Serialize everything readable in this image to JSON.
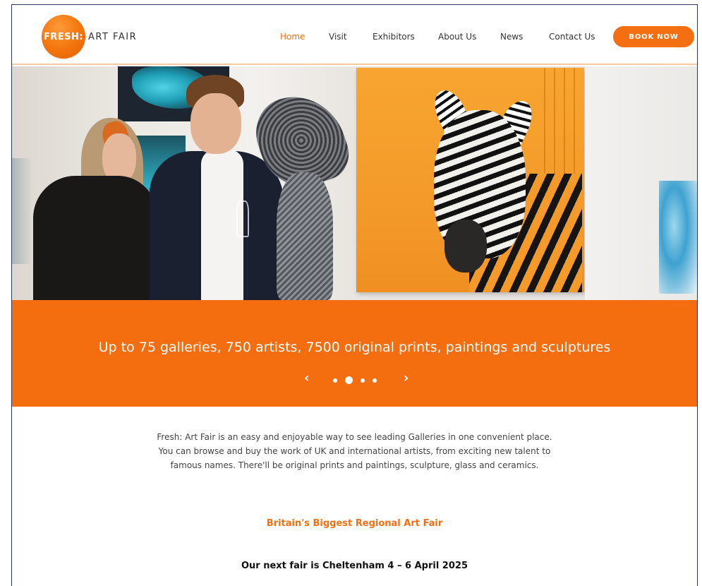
{
  "header": {
    "logo_mark": "FRESH:",
    "logo_text": "ART FAIR",
    "nav": [
      {
        "label": "Home",
        "active": true
      },
      {
        "label": "Visit"
      },
      {
        "label": "Exhibitors"
      },
      {
        "label": "About Us"
      },
      {
        "label": "News"
      },
      {
        "label": "Contact Us"
      }
    ],
    "book_label": "BOOK NOW"
  },
  "hero": {
    "banner_text": "Up to 75 galleries, 750 artists, 7500 original prints, paintings and sculptures",
    "prev_glyph": "‹",
    "next_glyph": "›",
    "slides_count": 4,
    "active_slide": 2
  },
  "intro": {
    "paragraph": "Fresh: Art Fair is an easy and enjoyable way to see leading Galleries in one convenient place. You can browse and buy the work of UK and international artists, from exciting new talent to famous names. There'll be original prints and paintings, sculpture, glass and ceramics.",
    "tagline": "Britain's Biggest Regional Art Fair",
    "next_fair": "Our next fair is Cheltenham 4 – 6 April 2025"
  },
  "colors": {
    "brand_orange": "#f36f12",
    "banner_orange": "#f46d0f",
    "frame_border": "#2d3a5c"
  }
}
